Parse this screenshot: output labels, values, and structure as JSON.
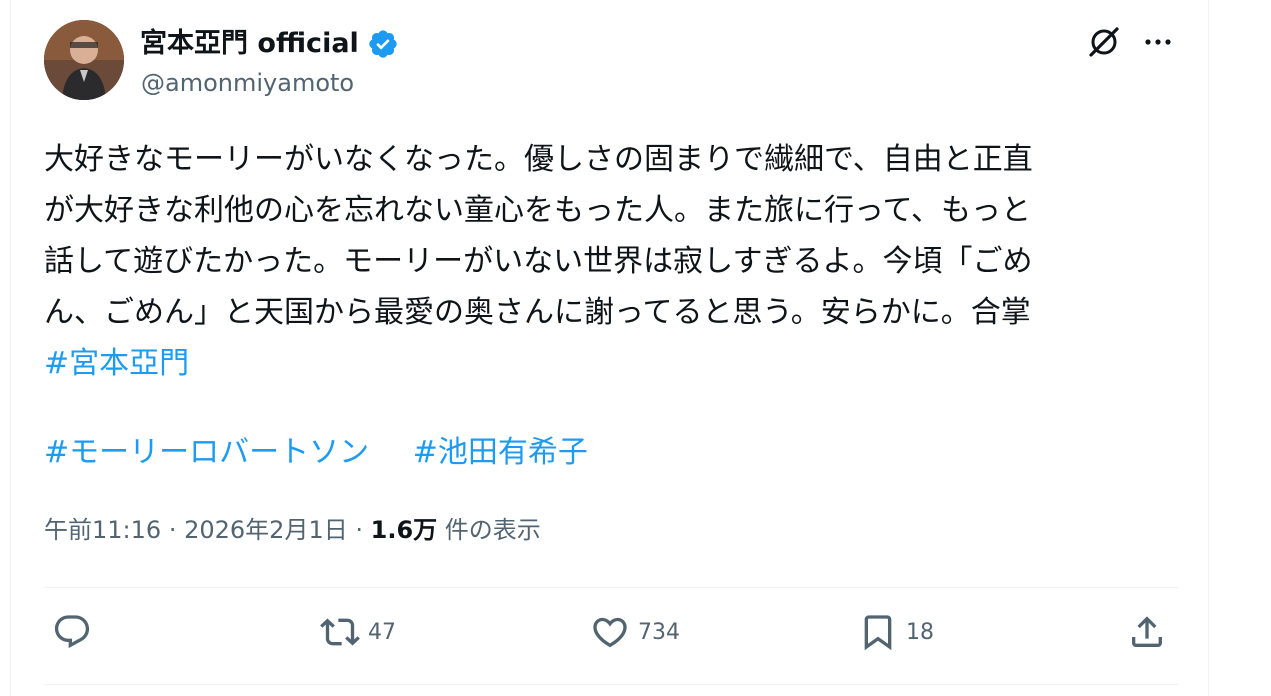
{
  "author": {
    "display_name": "宮本亞門 official",
    "handle": "@amonmiyamoto"
  },
  "tweet": {
    "lines": [
      "大好きなモーリーがいなくなった。優しさの固まりで繊細で、自由と正直",
      "が大好きな利他の心を忘れない童心をもった人。また旅に行って、もっと",
      "話して遊びたかった。モーリーがいない世界は寂しすぎるよ。今頃「ごめ",
      "ん、ごめん」と天国から最愛の奥さんに謝ってると思う。安らかに。合掌"
    ],
    "hashtag_inline": "#宮本亞門",
    "hashtags": [
      "#モーリーロバートソン",
      "#池田有希子"
    ]
  },
  "meta": {
    "time": "午前11:16",
    "separator": "·",
    "date": "2026年2月1日",
    "views_count": "1.6万",
    "views_label": "件の表示"
  },
  "actions": {
    "reply": {
      "icon": "reply-icon",
      "count": ""
    },
    "retweet": {
      "icon": "retweet-icon",
      "count": "47"
    },
    "like": {
      "icon": "heart-icon",
      "count": "734"
    },
    "bookmark": {
      "icon": "bookmark-icon",
      "count": "18"
    },
    "share": {
      "icon": "share-icon",
      "count": ""
    }
  },
  "colors": {
    "accent": "#1d9bf0",
    "text": "#0f1419",
    "secondary": "#536471",
    "divider": "#eff3f4"
  }
}
